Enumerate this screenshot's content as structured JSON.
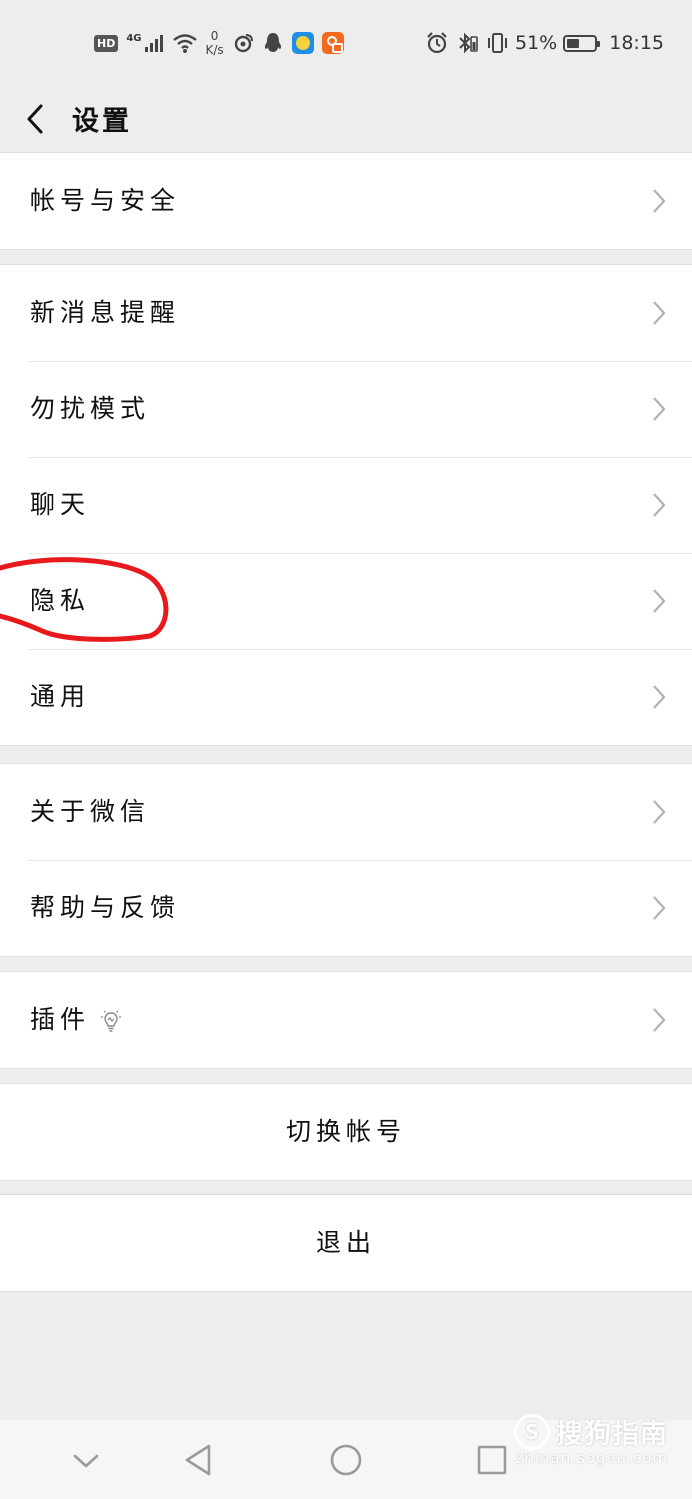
{
  "status_bar": {
    "hd": "HD",
    "network": "4G",
    "speed_value": "0",
    "speed_unit": "K/s",
    "battery_percent": "51%",
    "battery_level": 0.51,
    "time": "18:15",
    "icons": [
      "hd-badge",
      "signal-icon",
      "wifi-icon",
      "weibo-icon",
      "qq-icon",
      "app-icon-blue",
      "app-icon-orange",
      "alarm-icon",
      "bluetooth-icon",
      "vibrate-icon",
      "battery-icon"
    ]
  },
  "header": {
    "title": "设置"
  },
  "groups": {
    "account": {
      "label": "帐号与安全"
    },
    "notifications": {
      "label": "新消息提醒"
    },
    "dnd": {
      "label": "勿扰模式"
    },
    "chat": {
      "label": "聊天"
    },
    "privacy": {
      "label": "隐私"
    },
    "general": {
      "label": "通用"
    },
    "about": {
      "label": "关于微信"
    },
    "help": {
      "label": "帮助与反馈"
    },
    "plugins": {
      "label": "插件",
      "icon": "lightbulb-icon"
    }
  },
  "actions": {
    "switch_account": "切换帐号",
    "logout": "退出"
  },
  "colors": {
    "background": "#ededed",
    "row": "#ffffff",
    "annotation": "#e8191c"
  },
  "watermark": {
    "logo": "S",
    "text": "搜狗指南",
    "url": "zhinan.sogou.com"
  }
}
